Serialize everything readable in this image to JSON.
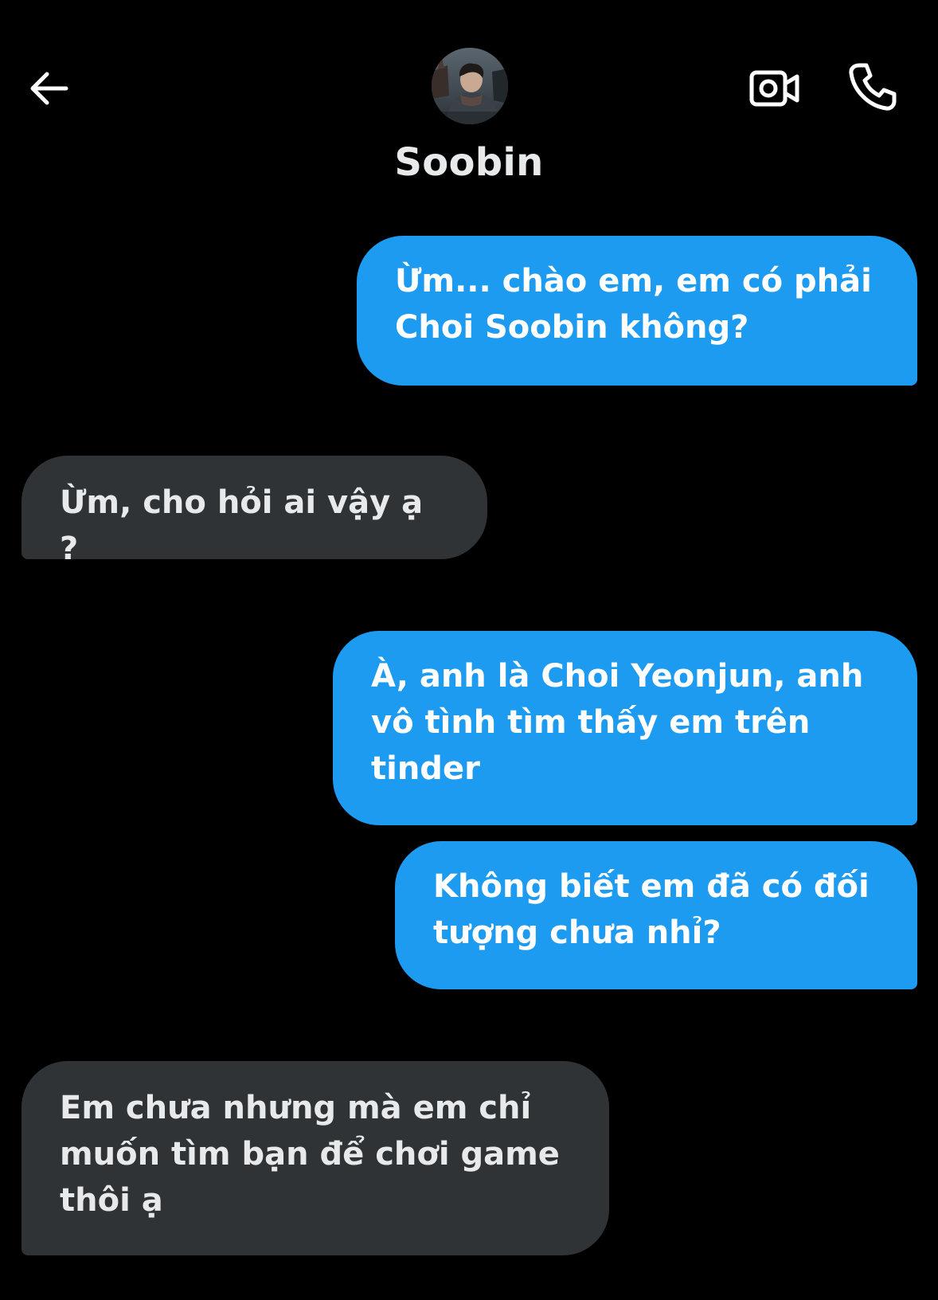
{
  "header": {
    "contact_name": "Soobin",
    "back_icon": "arrow-left-icon",
    "video_icon": "video-call-icon",
    "call_icon": "phone-icon"
  },
  "colors": {
    "background": "#000000",
    "outgoing_bubble": "#1d9bf0",
    "incoming_bubble": "#2f3336",
    "text": "#ffffff"
  },
  "messages": [
    {
      "direction": "outgoing",
      "text": "Ừm... chào em, em có phải Choi Soobin không?"
    },
    {
      "direction": "incoming",
      "text": "Ừm, cho hỏi ai vậy ạ ?"
    },
    {
      "direction": "outgoing",
      "text": "À, anh là Choi Yeonjun, anh vô tình tìm thấy em trên tinder"
    },
    {
      "direction": "outgoing",
      "text": "Không biết em đã có đối tượng chưa nhỉ?"
    },
    {
      "direction": "incoming",
      "text": "Em chưa nhưng mà em chỉ muốn tìm bạn để chơi game thôi ạ"
    }
  ]
}
